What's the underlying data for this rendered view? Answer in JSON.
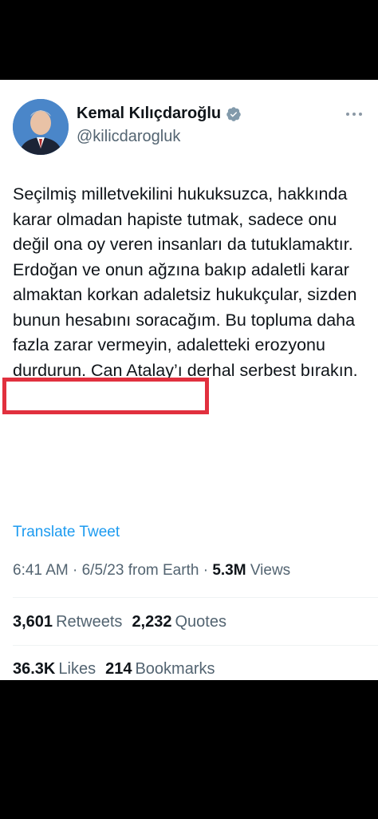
{
  "user": {
    "display_name": "Kemal Kılıçdaroğlu",
    "handle": "@kilicdarogluk",
    "verified": true
  },
  "tweet": {
    "text": "Seçilmiş milletvekilini hukuksuzca, hakkında karar olmadan hapiste tutmak, sadece onu değil ona oy veren insanları da tutuklamaktır. Erdoğan ve onun ağzına bakıp adaletli karar almaktan korkan adaletsiz hukukçular, sizden bunun hesabını soracağım. Bu topluma daha fazla zarar vermeyin, adaletteki erozyonu durdurun. Can Atalay’ı derhal serbest bırakın.",
    "highlighted_phrase": "hesabını soracağım."
  },
  "translate_label": "Translate Tweet",
  "meta": {
    "time": "6:41 AM",
    "date": "6/5/23",
    "source": "from Earth",
    "views_count": "5.3M",
    "views_label": "Views"
  },
  "stats": {
    "retweets_count": "3,601",
    "retweets_label": "Retweets",
    "quotes_count": "2,232",
    "quotes_label": "Quotes",
    "likes_count": "36.3K",
    "likes_label": "Likes",
    "bookmarks_count": "214",
    "bookmarks_label": "Bookmarks"
  },
  "colors": {
    "link": "#1d9bf0",
    "muted": "#536471",
    "highlight": "#e1303e"
  },
  "icons": {
    "verified": "verified-badge-icon",
    "more": "more-options-icon"
  }
}
